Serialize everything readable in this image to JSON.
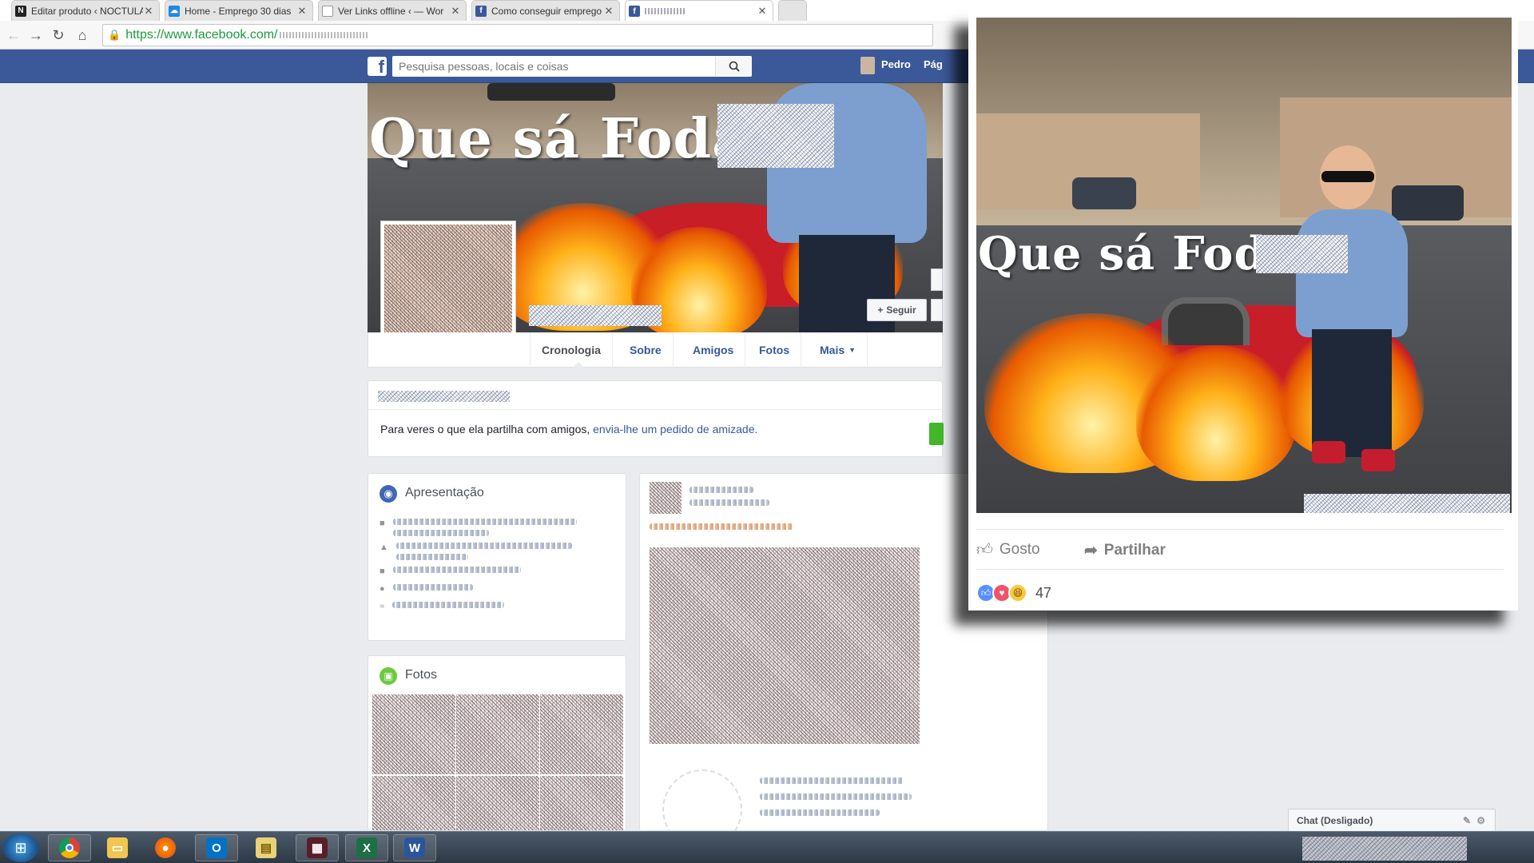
{
  "browser": {
    "tabs": [
      {
        "title": "Editar produto ‹ NOCTULA",
        "icon": "notion-n-icon",
        "color": "#222222"
      },
      {
        "title": "Home - Emprego 30 dias",
        "icon": "cloud-icon",
        "color": "#1e88e5"
      },
      {
        "title": "Ver Links offline ‹ — Wor",
        "icon": "page-icon",
        "color": "#777777"
      },
      {
        "title": "Como conseguir emprego",
        "icon": "facebook-icon",
        "color": "#3b5998"
      },
      {
        "title": "",
        "icon": "facebook-icon",
        "color": "#3b5998",
        "active": true
      }
    ],
    "url": "https://www.facebook.com/"
  },
  "facebook": {
    "search_placeholder": "Pesquisa pessoas, locais e coisas",
    "user_name": "Pedro",
    "header_more": "Pág",
    "cover_caption": "Que sá Foda",
    "follow_label": "Seguir",
    "nav": [
      "Cronologia",
      "Sobre",
      "Amigos",
      "Fotos",
      "Mais"
    ],
    "friend_notice_prefix": "Para veres o que ela partilha com amigos, ",
    "friend_notice_link": "envia-lhe um pedido de amizade.",
    "intro_title": "Apresentação",
    "photos_title": "Fotos",
    "chat_label": "Chat (Desligado)"
  },
  "popup": {
    "caption": "Que sá Foda",
    "like_label": "Gosto",
    "share_label": "Partilhar",
    "reaction_count": "47"
  },
  "colors": {
    "fb_blue": "#3b5998",
    "link_blue": "#365899",
    "bg": "#e9ebee"
  }
}
